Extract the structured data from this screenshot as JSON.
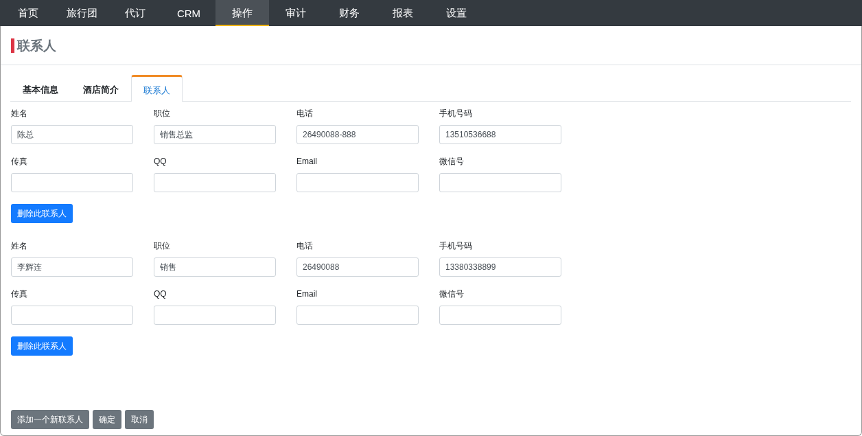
{
  "nav": [
    {
      "label": "首页",
      "selected": false
    },
    {
      "label": "旅行团",
      "selected": false
    },
    {
      "label": "代订",
      "selected": false
    },
    {
      "label": "CRM",
      "selected": false
    },
    {
      "label": "操作",
      "selected": true
    },
    {
      "label": "审计",
      "selected": false
    },
    {
      "label": "财务",
      "selected": false
    },
    {
      "label": "报表",
      "selected": false
    },
    {
      "label": "设置",
      "selected": false
    }
  ],
  "page_title": "联系人",
  "tabs": [
    {
      "label": "基本信息",
      "selected": false
    },
    {
      "label": "酒店简介",
      "selected": false
    },
    {
      "label": "联系人",
      "selected": true
    }
  ],
  "contacts": [
    {
      "fields": [
        {
          "label": "姓名",
          "value": "陈总"
        },
        {
          "label": "职位",
          "value": "销售总监"
        },
        {
          "label": "电话",
          "value": "26490088-888"
        },
        {
          "label": "手机号码",
          "value": "13510536688"
        },
        {
          "label": "传真"
        },
        {
          "label": "QQ"
        },
        {
          "label": "Email"
        },
        {
          "label": "微信号"
        }
      ],
      "delete_button": "删除此联系人"
    },
    {
      "fields": [
        {
          "label": "姓名",
          "value": "李辉连"
        },
        {
          "label": "职位",
          "value": "销售"
        },
        {
          "label": "电话",
          "value": "26490088"
        },
        {
          "label": "手机号码",
          "value": "13380338899"
        },
        {
          "label": "传真"
        },
        {
          "label": "QQ"
        },
        {
          "label": "Email"
        },
        {
          "label": "微信号"
        }
      ],
      "delete_button": "删除此联系人"
    }
  ],
  "footer_buttons": [
    "添加一个新联系人",
    "确定",
    "取消"
  ]
}
